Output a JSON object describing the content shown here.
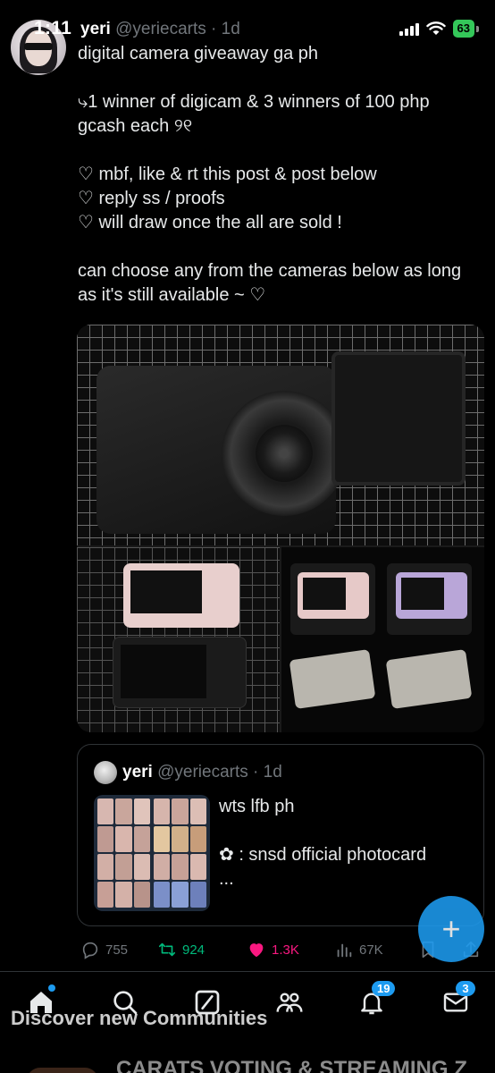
{
  "status_bar": {
    "time": "1:11",
    "battery": "63"
  },
  "tweet": {
    "name": "yeri",
    "handle": "@yeriecarts",
    "dot": "·",
    "time": "1d",
    "lines": [
      "digital camera giveaway ga ph",
      "",
      "⤷1 winner of digicam & 3 winners of 100 php gcash each ୨୧",
      "",
      "♡ mbf, like & rt this post & post below",
      "♡ reply ss / proofs",
      "♡ will draw once the all are sold !",
      "",
      "can choose any from the cameras below as long as it's still available ~ ♡"
    ]
  },
  "quote": {
    "name": "yeri",
    "handle": "@yeriecarts",
    "dot": "·",
    "time": "1d",
    "text_line1": "wts lfb ph",
    "text_line2": "✿ : snsd official photocard",
    "text_line3": "..."
  },
  "actions": {
    "replies": "755",
    "retweets": "924",
    "likes": "1.3K",
    "views": "67K"
  },
  "fab": {
    "label": "+"
  },
  "bottom_nav": {
    "notifications_badge": "19",
    "messages_badge": "3",
    "communities_banner": "Discover new Communities",
    "peek_text": "CARATS VOTING & STREAMING Z"
  },
  "colors": {
    "accent": "#1d9bf0",
    "like": "#f91880",
    "retweet": "#00ba7c",
    "muted": "#71767b",
    "battery": "#34c759"
  }
}
